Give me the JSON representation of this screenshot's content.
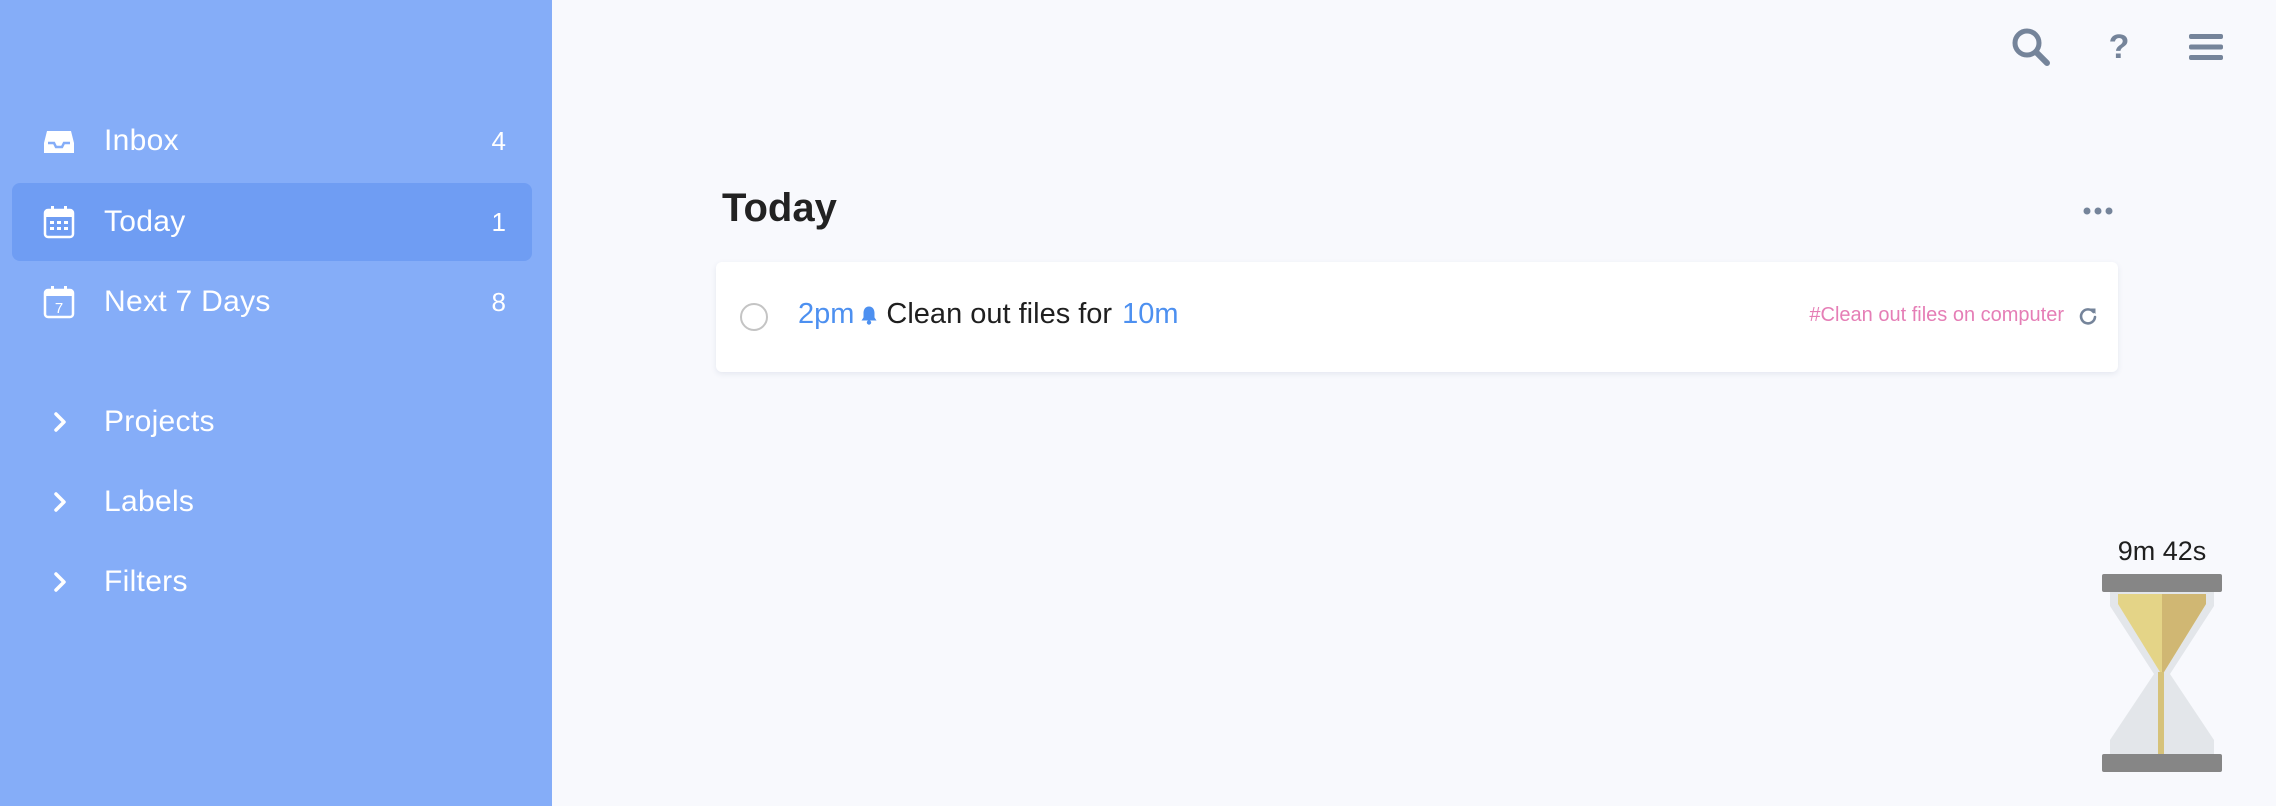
{
  "sidebar": {
    "nav": [
      {
        "id": "inbox",
        "label": "Inbox",
        "count": "4",
        "icon": "inbox-icon"
      },
      {
        "id": "today",
        "label": "Today",
        "count": "1",
        "icon": "calendar-icon",
        "active": true
      },
      {
        "id": "next7",
        "label": "Next 7 Days",
        "count": "8",
        "icon": "calendar-7-icon",
        "icon_text": "7"
      }
    ],
    "sections": [
      {
        "id": "projects",
        "label": "Projects",
        "icon": "chevron-right-icon"
      },
      {
        "id": "labels",
        "label": "Labels",
        "icon": "chevron-right-icon"
      },
      {
        "id": "filters",
        "label": "Filters",
        "icon": "chevron-right-icon"
      }
    ]
  },
  "toolbar": {
    "icons": [
      "search-icon",
      "help-icon",
      "menu-icon"
    ],
    "help_glyph": "?"
  },
  "main": {
    "title": "Today",
    "more_icon": "more-horizontal-icon",
    "tasks": [
      {
        "time": "2pm",
        "reminder_icon": "bell-icon",
        "text": "Clean out files for",
        "duration": "10m",
        "tag": "#Clean out files on computer",
        "repeat_icon": "repeat-icon"
      }
    ]
  },
  "timer": {
    "remaining": "9m 42s",
    "icon": "hourglass-icon"
  },
  "colors": {
    "sidebar_bg": "#85adf8",
    "sidebar_active": "#6f9df3",
    "page_bg": "#f8f9fd",
    "accent_blue": "#4d90f0",
    "tag_pink": "#e57eb6",
    "icon_gray": "#75849a"
  }
}
